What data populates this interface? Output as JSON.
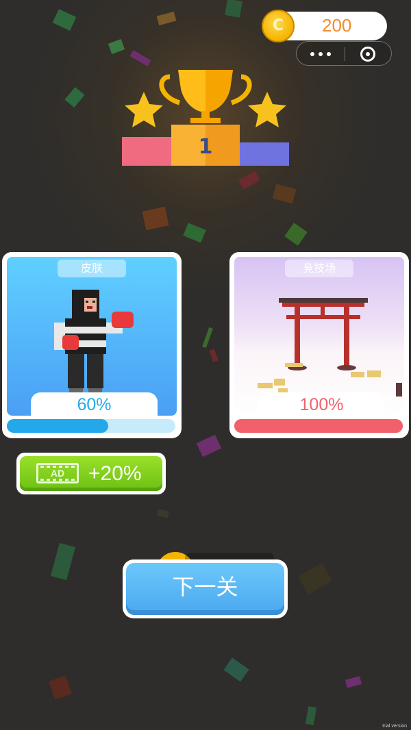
{
  "coins": {
    "icon_letter": "C",
    "value": "200"
  },
  "capsule": {
    "more_icon": "more-dots-icon",
    "close_icon": "target-close-icon"
  },
  "trophy": {
    "podium_number": "1"
  },
  "cards": {
    "skin": {
      "label": "皮肤",
      "percent": "60%",
      "progress": 0.6,
      "color": "#23a9ea"
    },
    "arena": {
      "label": "竞技场",
      "percent": "100%",
      "progress": 1.0,
      "color": "#f2606b"
    }
  },
  "ad_button": {
    "icon_text": "AD",
    "label": "+20%"
  },
  "next_button": {
    "label": "下一关"
  },
  "watermark": "trial version"
}
